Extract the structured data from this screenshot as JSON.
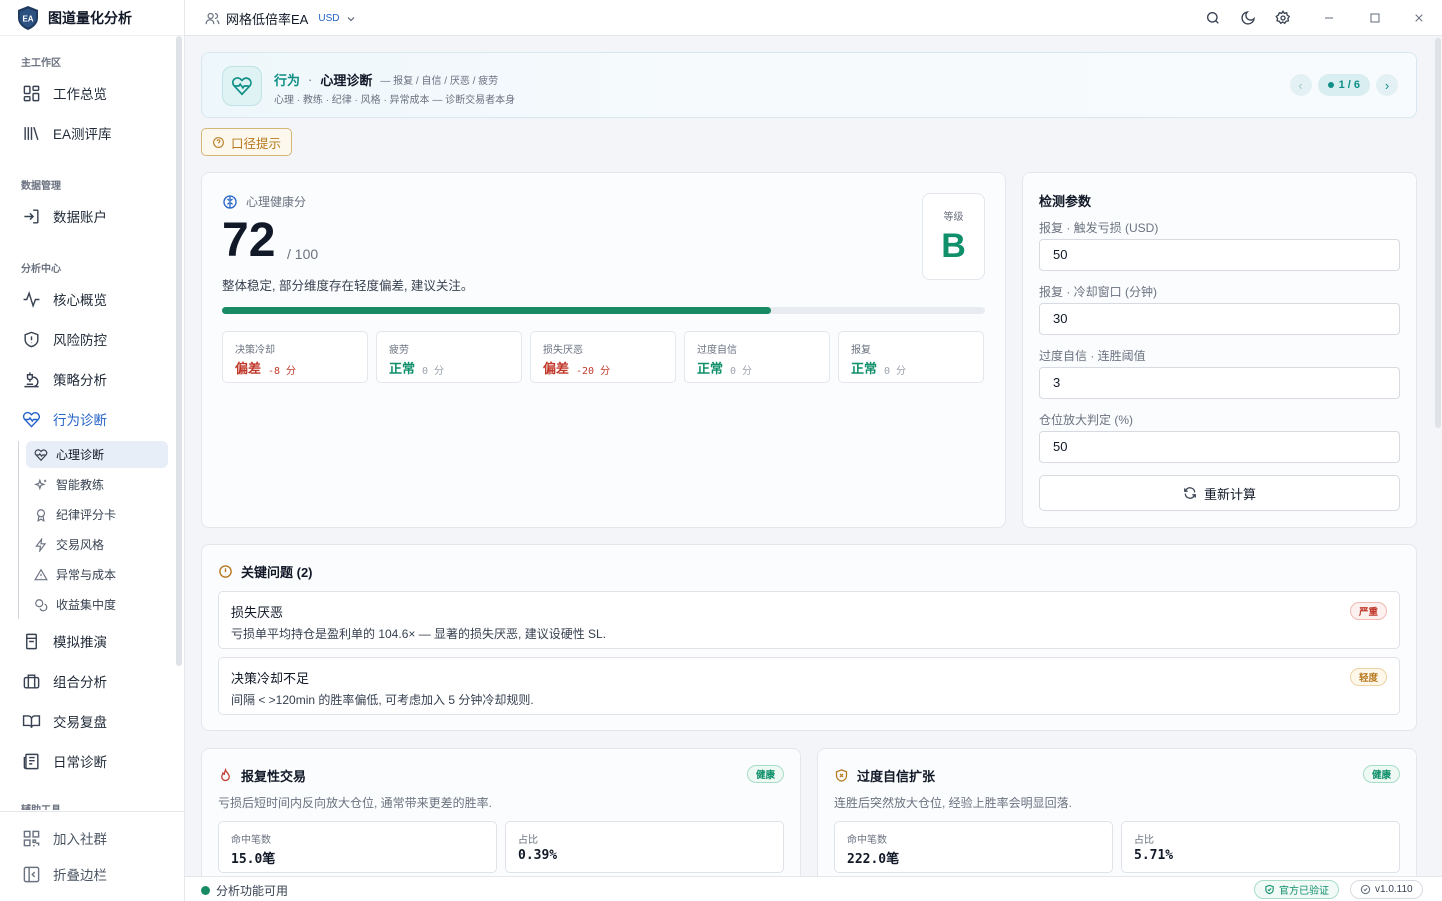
{
  "app": {
    "logo_text": "EA",
    "name": "图道量化分析"
  },
  "sidebar": {
    "sections": [
      "主工作区",
      "数据管理",
      "分析中心",
      "辅助工具"
    ],
    "items": [
      {
        "label": "工作总览",
        "icon": "dashboard-icon"
      },
      {
        "label": "EA测评库",
        "icon": "library-icon"
      },
      {
        "label": "数据账户",
        "icon": "login-icon"
      },
      {
        "label": "核心概览",
        "icon": "activity-icon"
      },
      {
        "label": "风险防控",
        "icon": "shield-icon"
      },
      {
        "label": "策略分析",
        "icon": "microscope-icon"
      },
      {
        "label": "行为诊断",
        "icon": "heart-pulse-icon"
      },
      {
        "label": "模拟推演",
        "icon": "flask-icon"
      },
      {
        "label": "组合分析",
        "icon": "briefcase-icon"
      },
      {
        "label": "交易复盘",
        "icon": "book-icon"
      },
      {
        "label": "日常诊断",
        "icon": "newspaper-icon"
      }
    ],
    "subitems": [
      {
        "label": "心理诊断",
        "icon": "heart-pulse-icon"
      },
      {
        "label": "智能教练",
        "icon": "sparkles-icon"
      },
      {
        "label": "纪律评分卡",
        "icon": "award-icon"
      },
      {
        "label": "交易风格",
        "icon": "zap-icon"
      },
      {
        "label": "异常与成本",
        "icon": "alert-triangle-icon"
      },
      {
        "label": "收益集中度",
        "icon": "coins-icon"
      }
    ],
    "join_community": "加入社群",
    "collapse_sidebar": "折叠边栏"
  },
  "topbar": {
    "account_name": "网格低倍率EA",
    "currency": "USD"
  },
  "header": {
    "category": "行为",
    "separator": "·",
    "title": "心理诊断",
    "tags": "— 报复 / 自信 / 厌恶 / 疲劳",
    "subtitle": "心理 · 教练 · 纪律 · 风格 · 异常成本 — 诊断交易者本身",
    "page_indicator": "1 / 6"
  },
  "hint_button": "口径提示",
  "score": {
    "label": "心理健康分",
    "value": "72",
    "max": "/ 100",
    "progress": 0.72,
    "description": "整体稳定, 部分维度存在轻度偏差, 建议关注。",
    "grade_label": "等级",
    "grade": "B",
    "metrics": [
      {
        "name": "决策冷却",
        "status": "偏差",
        "delta": "-8 分",
        "state": "bad"
      },
      {
        "name": "疲劳",
        "status": "正常",
        "delta": "0 分",
        "state": "ok"
      },
      {
        "name": "损失厌恶",
        "status": "偏差",
        "delta": "-20 分",
        "state": "bad"
      },
      {
        "name": "过度自信",
        "status": "正常",
        "delta": "0 分",
        "state": "ok"
      },
      {
        "name": "报复",
        "status": "正常",
        "delta": "0 分",
        "state": "ok"
      }
    ]
  },
  "params": {
    "title": "检测参数",
    "fields": [
      {
        "label": "报复 · 触发亏损 (USD)",
        "value": "50"
      },
      {
        "label": "报复 · 冷却窗口 (分钟)",
        "value": "30"
      },
      {
        "label": "过度自信 · 连胜阈值",
        "value": "3"
      },
      {
        "label": "仓位放大判定 (%)",
        "value": "50"
      }
    ],
    "recalc_label": "重新计算"
  },
  "issues": {
    "title": "关键问题 (2)",
    "items": [
      {
        "title": "损失厌恶",
        "desc": "亏损单平均持仓是盈利单的 104.6× — 显著的损失厌恶, 建议设硬性 SL.",
        "severity": "严重"
      },
      {
        "title": "决策冷却不足",
        "desc": "间隔 < >120min 的胜率偏低, 可考虑加入 5 分钟冷却规则.",
        "severity": "轻度"
      }
    ]
  },
  "bottom_cards": [
    {
      "title": "报复性交易",
      "badge": "健康",
      "desc": "亏损后短时间内反向放大仓位, 通常带来更差的胜率.",
      "stats": [
        {
          "label": "命中笔数",
          "value": "15.0笔"
        },
        {
          "label": "占比",
          "value": "0.39%"
        }
      ]
    },
    {
      "title": "过度自信扩张",
      "badge": "健康",
      "desc": "连胜后突然放大仓位, 经验上胜率会明显回落.",
      "stats": [
        {
          "label": "命中笔数",
          "value": "222.0笔"
        },
        {
          "label": "占比",
          "value": "5.71%"
        }
      ]
    }
  ],
  "status": {
    "text": "分析功能可用",
    "verified": "官方已验证",
    "version": "v1.0.110"
  },
  "colors": {
    "accent": "#2563c9",
    "teal": "#0f8f86",
    "good": "#0f8f6a",
    "bad": "#c0392b",
    "warn": "#b7791f"
  }
}
